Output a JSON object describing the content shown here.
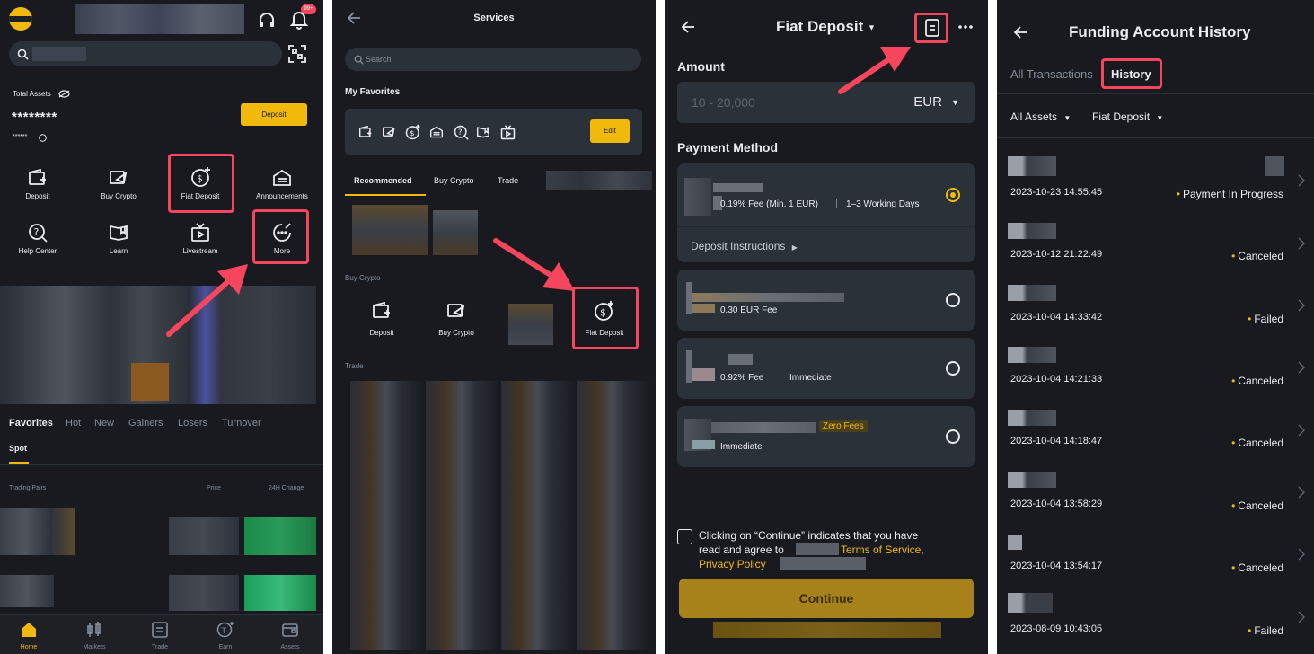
{
  "colors": {
    "background": "#181a20",
    "card": "#2b3139",
    "accent": "#f0b90b",
    "highlight": "#f6465d",
    "text": "#eaecef",
    "muted": "#848e9c"
  },
  "screen1": {
    "notification_badge": "99+",
    "total_assets_label": "Total Assets",
    "total_assets_value": "********",
    "sub_value": "******",
    "deposit_button": "Deposit",
    "shortcuts": [
      {
        "label": "Deposit",
        "icon": "deposit-icon"
      },
      {
        "label": "Buy Crypto",
        "icon": "buy-crypto-icon"
      },
      {
        "label": "Fiat Deposit",
        "icon": "fiat-deposit-icon"
      },
      {
        "label": "Announcements",
        "icon": "announcements-icon"
      },
      {
        "label": "Help Center",
        "icon": "help-center-icon"
      },
      {
        "label": "Learn",
        "icon": "learn-icon"
      },
      {
        "label": "Livestream",
        "icon": "livestream-icon"
      },
      {
        "label": "More",
        "icon": "more-icon"
      }
    ],
    "market_tabs": [
      "Favorites",
      "Hot",
      "New",
      "Gainers",
      "Losers",
      "Turnover"
    ],
    "spot_tab": "Spot",
    "col_pairs": "Trading Pairs",
    "col_price": "Price",
    "col_change": "24H Change",
    "bottom_nav": [
      "Home",
      "Markets",
      "Trade",
      "Earn",
      "Assets"
    ]
  },
  "screen2": {
    "title": "Services",
    "search_placeholder": "Search",
    "favorites_heading": "My Favorites",
    "edit_button": "Edit",
    "tabs": [
      "Recommended",
      "Buy Crypto",
      "Trade"
    ],
    "buy_crypto_heading": "Buy Crypto",
    "buy_items": [
      "Deposit",
      "Buy Crypto",
      "Fiat Deposit"
    ],
    "trade_heading": "Trade"
  },
  "screen3": {
    "title": "Fiat Deposit",
    "amount_label": "Amount",
    "amount_placeholder": "10 - 20,000",
    "currency": "EUR",
    "payment_method_label": "Payment Method",
    "methods": [
      {
        "fee": "0.19% Fee (Min. 1 EUR)",
        "time": "1–3 Working Days",
        "selected": true
      },
      {
        "fee": "0.30 EUR Fee",
        "time": "",
        "selected": false
      },
      {
        "fee": "0.92% Fee",
        "time": "Immediate",
        "selected": false
      },
      {
        "fee": "Immediate",
        "time": "",
        "badge": "Zero Fees",
        "selected": false
      }
    ],
    "deposit_instructions": "Deposit Instructions",
    "agree_text_1": "Clicking on “Continue” indicates that you have",
    "agree_text_2": "read and agree to",
    "terms_link": "Terms of Service,",
    "privacy_link": "Privacy Policy",
    "continue_button": "Continue"
  },
  "screen4": {
    "title": "Funding Account History",
    "tabs": [
      "All Transactions",
      "History"
    ],
    "filter_assets": "All Assets",
    "filter_type": "Fiat Deposit",
    "rows": [
      {
        "date": "2023-10-23 14:55:45",
        "status": "Payment In Progress"
      },
      {
        "date": "2023-10-12 21:22:49",
        "status": "Canceled"
      },
      {
        "date": "2023-10-04 14:33:42",
        "status": "Failed"
      },
      {
        "date": "2023-10-04 14:21:33",
        "status": "Canceled"
      },
      {
        "date": "2023-10-04 14:18:47",
        "status": "Canceled"
      },
      {
        "date": "2023-10-04 13:58:29",
        "status": "Canceled"
      },
      {
        "date": "2023-10-04 13:54:17",
        "status": "Canceled"
      },
      {
        "date": "2023-08-09 10:43:05",
        "status": "Failed"
      }
    ]
  }
}
